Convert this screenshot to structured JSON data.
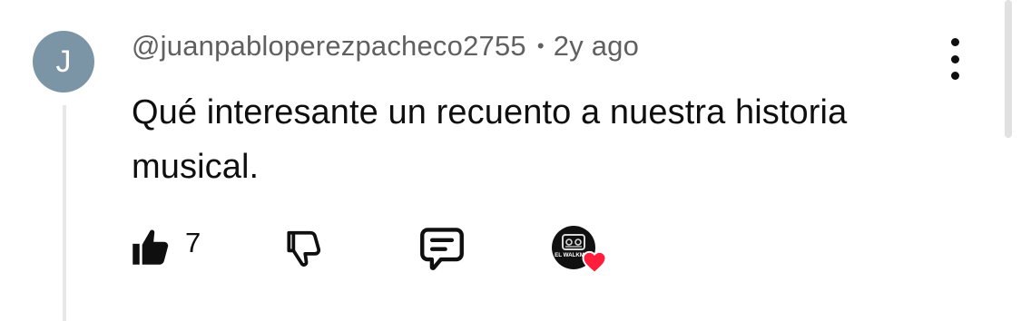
{
  "comment": {
    "avatar_initial": "J",
    "author": "@juanpabloperezpacheco2755",
    "separator": "•",
    "age": "2y ago",
    "text": "Qué interesante un recuento a nuestra historia musical.",
    "like_count": "7",
    "creator_heart_badge_text": "EL WALKMAN"
  },
  "icons": {
    "like": "thumbs-up-icon",
    "dislike": "thumbs-down-icon",
    "reply": "reply-comment-icon",
    "more": "more-vertical-icon",
    "heart": "heart-icon"
  },
  "colors": {
    "avatar": "#7c95a6",
    "meta_text": "#606060",
    "text": "#0f0f0f",
    "heart": "#ff1f3d"
  }
}
